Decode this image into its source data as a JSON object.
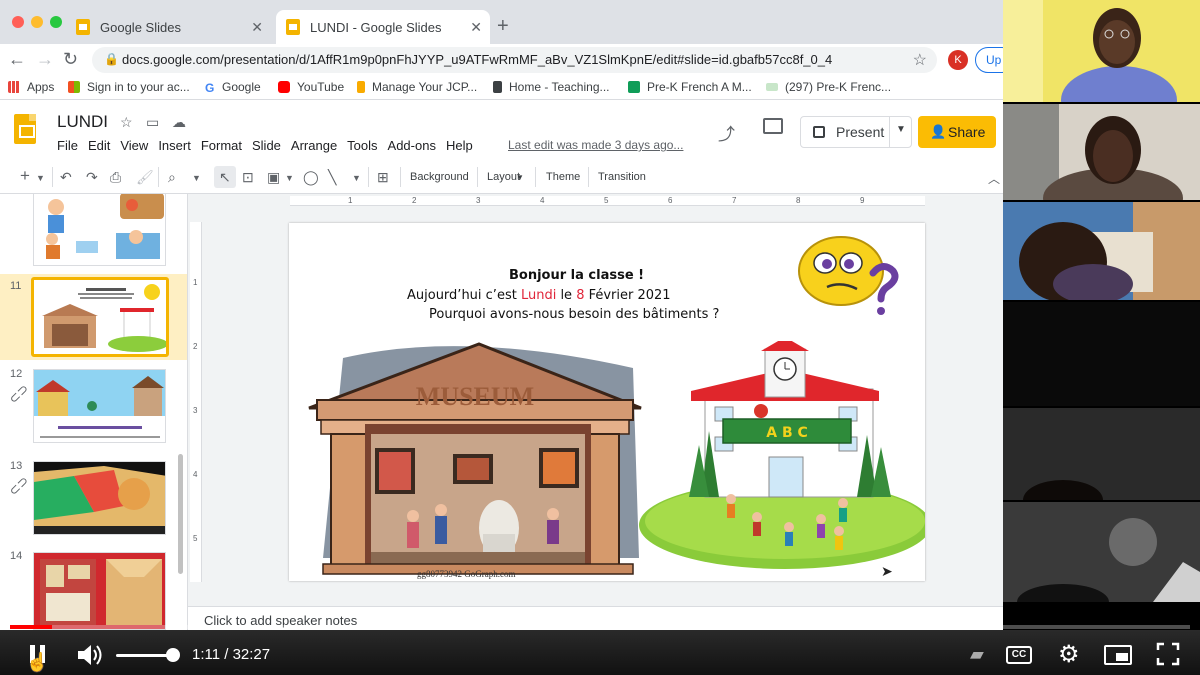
{
  "browser": {
    "tabs": [
      {
        "label": "Google Slides",
        "active": false
      },
      {
        "label": "LUNDI - Google Slides",
        "active": true
      }
    ],
    "new_tab": "+",
    "url": "docs.google.com/presentation/d/1AffR1m9p0pnFhJYYP_u9ATFwRmMF_aBv_VZ1SlmKpnE/edit#slide=id.gbafb57cc8f_0_4",
    "profile_initial": "K",
    "update_label": "Up",
    "bookmarks": [
      "Apps",
      "Sign in to your ac...",
      "Google",
      "YouTube",
      "Manage Your JCP...",
      "Home - Teaching...",
      "Pre-K French A M...",
      "(297) Pre-K Frenc..."
    ]
  },
  "slides": {
    "doc_title": "LUNDI",
    "menu": [
      "File",
      "Edit",
      "View",
      "Insert",
      "Format",
      "Slide",
      "Arrange",
      "Tools",
      "Add-ons",
      "Help"
    ],
    "last_edit": "Last edit was made 3 days ago...",
    "present_label": "Present",
    "share_label": "Share",
    "toolbar_labels": {
      "background": "Background",
      "layout": "Layout",
      "theme": "Theme",
      "transition": "Transition"
    },
    "filmstrip": [
      {
        "number": "",
        "partial": true
      },
      {
        "number": "11",
        "selected": true
      },
      {
        "number": "12"
      },
      {
        "number": "13"
      },
      {
        "number": "14"
      }
    ],
    "ruler_top": [
      "1",
      "2",
      "3",
      "4",
      "5",
      "6",
      "7",
      "8",
      "9"
    ],
    "ruler_left": [
      "1",
      "2",
      "3",
      "4",
      "5"
    ],
    "current_slide": {
      "line1": "Bonjour la classe !",
      "line2_a": "Aujourd’hui c’est ",
      "line2_day": "Lundi",
      "line2_b": " le ",
      "line2_date": "8",
      "line2_c": " Février 2021",
      "line3": "Pourquoi avons-nous besoin des bâtiments ?",
      "museum_sign": "MUSEUM",
      "school_sign": "A B C",
      "watermark": "gg80773942 GoGraph.com"
    },
    "speaker_notes_placeholder": "Click to add speaker notes"
  },
  "player": {
    "time": "1:11 / 32:27",
    "progress": 0.036,
    "volume": 0.85,
    "cc_label": "CC"
  },
  "colors": {
    "slides_yellow": "#f4b400",
    "share_button": "#fbbc04",
    "progress_red": "#ff0000",
    "accent_red_text": "#e0263a"
  }
}
